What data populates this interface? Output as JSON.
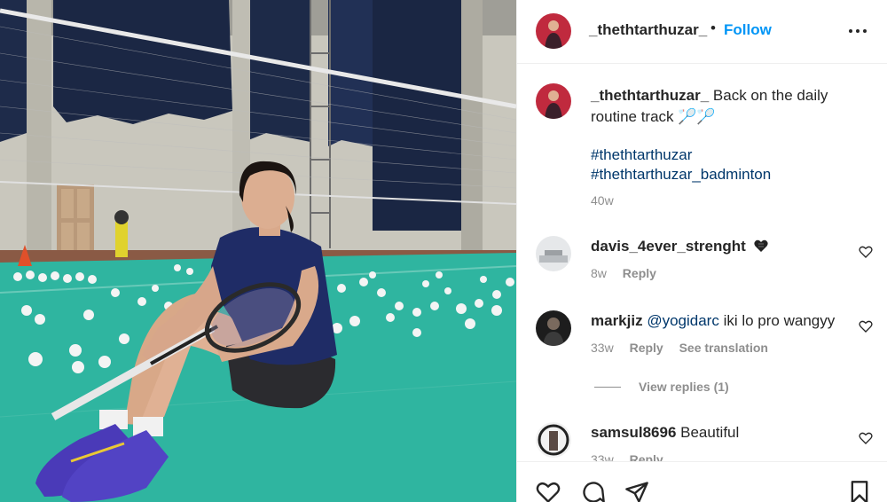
{
  "post": {
    "author": "_thethtarthuzar_",
    "follow_label": "Follow",
    "separator": "•"
  },
  "caption": {
    "username": "_thethtarthuzar_",
    "text": " Back on the daily routine track 🏸🏸",
    "hashtags": [
      "#thethtarthuzar",
      "#thethtarthuzar_badminton"
    ],
    "time": "40w"
  },
  "comments": [
    {
      "username": "davis_4ever_strenght",
      "text": "",
      "emoji": "black-heart",
      "time": "8w",
      "reply_label": "Reply"
    },
    {
      "username": "markjiz",
      "mention": "@yogidarc",
      "text": " iki lo pro wangyy",
      "time": "33w",
      "reply_label": "Reply",
      "translate_label": "See translation"
    },
    {
      "username": "samsul8696",
      "text": " Beautiful",
      "time": "33w",
      "reply_label": "Reply"
    }
  ],
  "view_replies_label": "View replies (1)",
  "icons": {
    "more": "more-options-icon",
    "like": "heart-icon",
    "comment": "comment-icon",
    "share": "paper-plane-icon",
    "save": "bookmark-icon"
  },
  "colors": {
    "accent": "#0095f6",
    "hashtag": "#00376b",
    "muted": "#8e8e8e",
    "court": "#2fb5a0"
  }
}
